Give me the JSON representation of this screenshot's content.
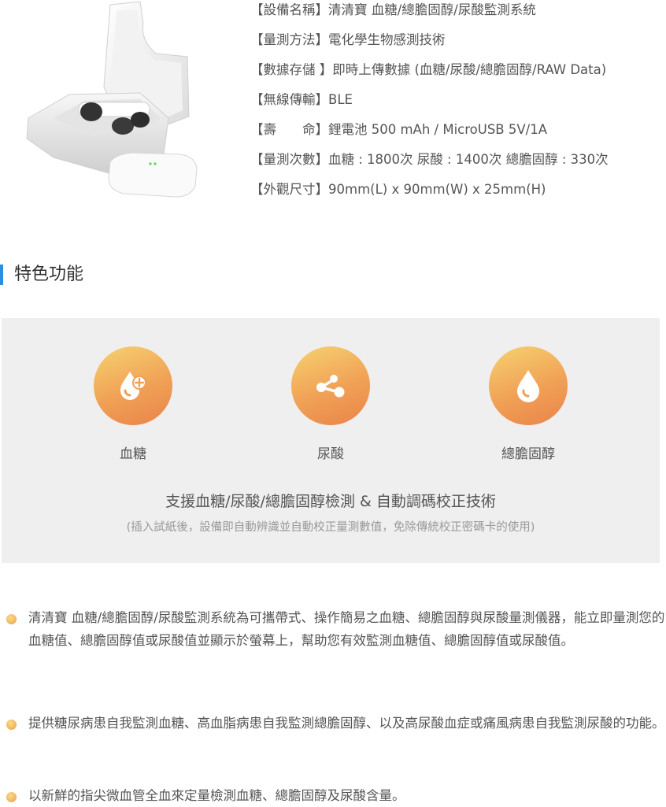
{
  "specs": [
    {
      "label": "【設備名稱】",
      "value": "清清寶 血糖/總膽固醇/尿酸監測系統"
    },
    {
      "label": "【量測方法】",
      "value": "電化學生物感測技術"
    },
    {
      "label": "【數據存儲 】",
      "value": "即時上傳數據 (血糖/尿酸/總膽固醇/RAW Data)"
    },
    {
      "label": "【無線傳輸】",
      "value": "BLE"
    },
    {
      "label": "【壽　　命】",
      "value": "鋰電池 500 mAh / MicroUSB 5V/1A"
    },
    {
      "label": "【量測次數】",
      "value": "血糖 : 1800次 尿酸 : 1400次 總膽固醇 : 330次"
    },
    {
      "label": "【外觀尺寸】",
      "value": "90mm(L) x 90mm(W) x 25mm(H)"
    }
  ],
  "section": {
    "title": "特色功能"
  },
  "features": [
    {
      "icon": "blood-drop-plus-icon",
      "label": "血糖"
    },
    {
      "icon": "molecule-share-icon",
      "label": "尿酸"
    },
    {
      "icon": "drop-icon",
      "label": "總膽固醇"
    }
  ],
  "panel": {
    "title": "支援血糖/尿酸/總膽固醇檢測 & 自動調碼校正技術",
    "subtitle": "(插入試紙後，設備即自動辨識並自動校正量測數值，免除傳統校正密碼卡的使用)"
  },
  "bullets": [
    "清清寶 血糖/總膽固醇/尿酸監測系統為可攜帶式、操作簡易之血糖、總膽固醇與尿酸量測儀器，能立即量測您的血糖值、總膽固醇值或尿酸值並顯示於螢幕上，幫助您有效監測血糖值、總膽固醇值或尿酸值。",
    "提供糖尿病患自我監測血糖、高血脂病患自我監測總膽固醇、以及高尿酸血症或痛風病患自我監測尿酸的功能。",
    "以新鮮的指尖微血管全血來定量檢測血糖、總膽固醇及尿酸含量。"
  ],
  "colors": {
    "accent": "#2a8fe3",
    "icon_gradient_start": "#f7d270",
    "icon_gradient_end": "#ea8349",
    "panel_bg": "#efefef"
  }
}
